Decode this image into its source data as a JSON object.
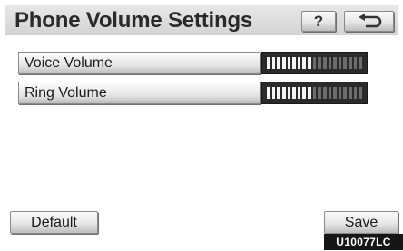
{
  "header": {
    "title": "Phone Volume Settings",
    "help_label": "?",
    "back_icon": "back-arrow-icon"
  },
  "settings": [
    {
      "label": "Voice Volume",
      "level": 9,
      "max": 19
    },
    {
      "label": "Ring Volume",
      "level": 9,
      "max": 19
    }
  ],
  "footer": {
    "default_label": "Default",
    "save_label": "Save"
  },
  "figure_code": "U10077LC"
}
